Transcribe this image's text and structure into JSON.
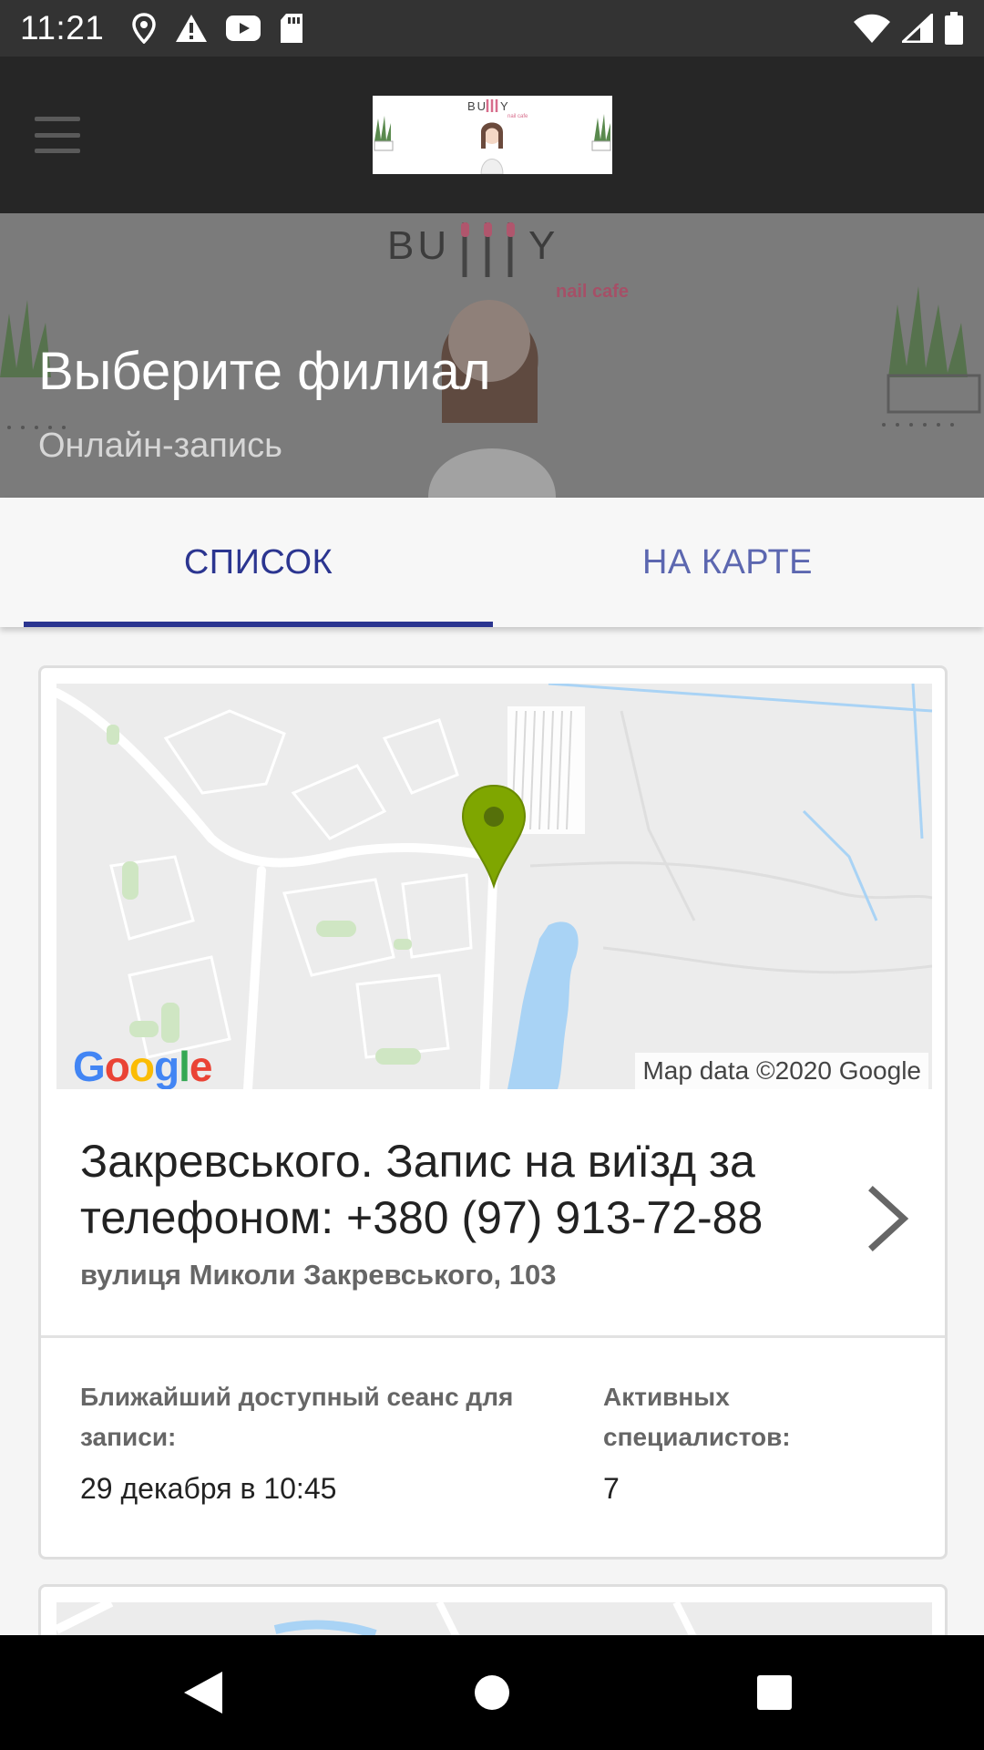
{
  "status_bar": {
    "time": "11:21",
    "left_icons": [
      "location-icon",
      "warning-icon",
      "youtube-icon",
      "sd-card-icon"
    ],
    "right_icons": [
      "wifi-icon",
      "signal-icon",
      "battery-icon"
    ]
  },
  "toolbar": {
    "menu_icon": "hamburger-menu-icon",
    "logo_text": "BUNNY",
    "logo_subtext": "nail cafe"
  },
  "header": {
    "title": "Выберите филиал",
    "subtitle": "Онлайн-запись",
    "art_text": "BUNNY",
    "art_subtext": "nail cafe"
  },
  "tabs": {
    "list_label": "СПИСОК",
    "map_label": "НА КАРТЕ",
    "selected": "list"
  },
  "branches": [
    {
      "name": "Закревського. Запис на виїзд за телефоном: +380 (97) 913-72-88",
      "address": "вулиця Миколи Закревського, 103",
      "map_credit": "Map data ©2020 Google",
      "map_logo": "Google",
      "nearest_label": "Ближайший доступный сеанс для записи:",
      "nearest_value": "29 декабря в 10:45",
      "specialists_label": "Активных специалистов:",
      "specialists_value": "7"
    }
  ],
  "colors": {
    "accent": "#2b3590",
    "toolbar": "#262626",
    "status_bar": "#333333",
    "map_pin": "#7fa600",
    "water": "#a9d3f5"
  },
  "nav_bar": {
    "back_icon": "back-triangle-icon",
    "home_icon": "home-circle-icon",
    "recents_icon": "recents-square-icon"
  }
}
